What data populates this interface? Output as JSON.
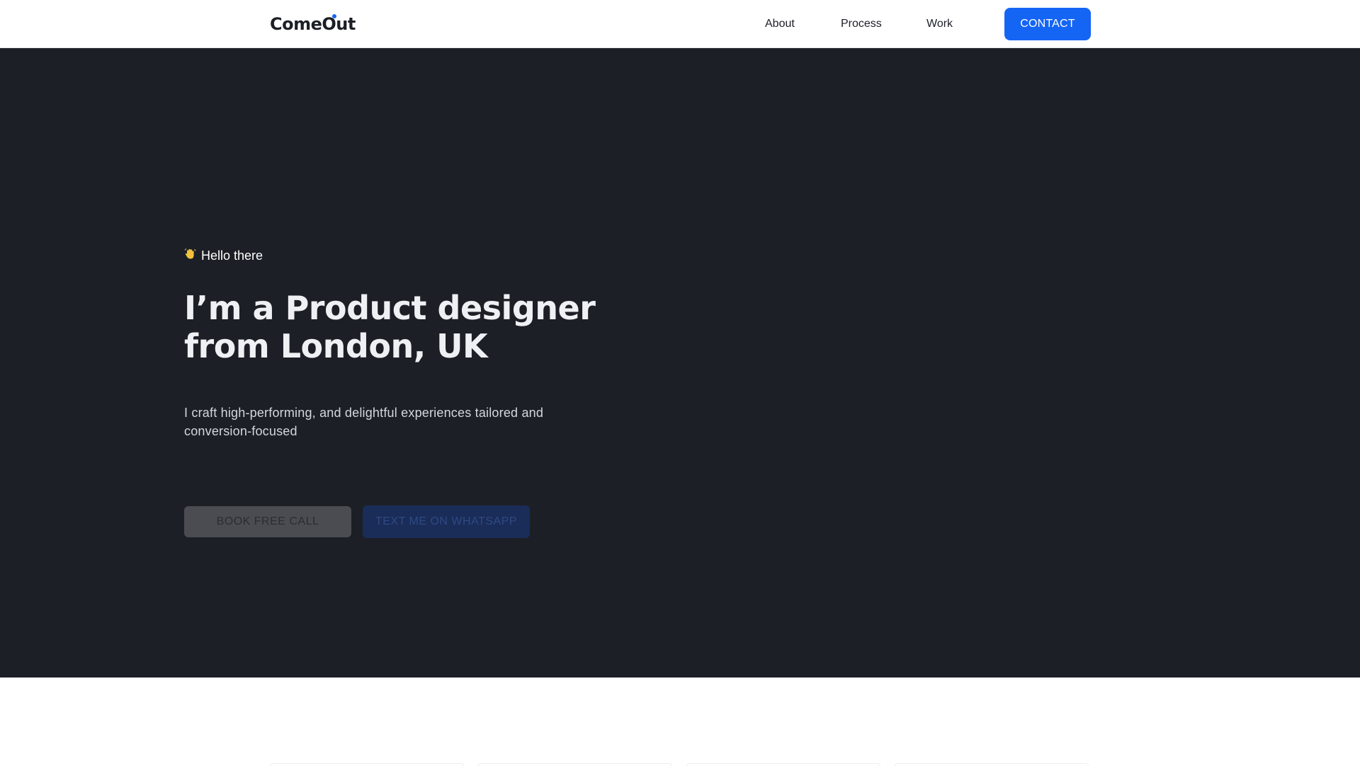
{
  "header": {
    "logo_text": "ComeOut",
    "nav": [
      {
        "label": "About"
      },
      {
        "label": "Process"
      },
      {
        "label": "Work"
      }
    ],
    "contact_label": "CONTACT"
  },
  "hero": {
    "greeting_icon": "waving-hand-icon",
    "greeting": "Hello there",
    "headline_line1": "I’m a Product designer",
    "headline_line2": "from London, UK",
    "subtext": "I craft high-performing, and delightful experiences tailored and conversion-focused",
    "book_label": "BOOK FREE CALL",
    "whatsapp_label": "TEXT ME ON WHATSAPP"
  },
  "colors": {
    "accent": "#1565f5",
    "hero_background": "#1c1f26",
    "page_background": "#ffffff"
  }
}
